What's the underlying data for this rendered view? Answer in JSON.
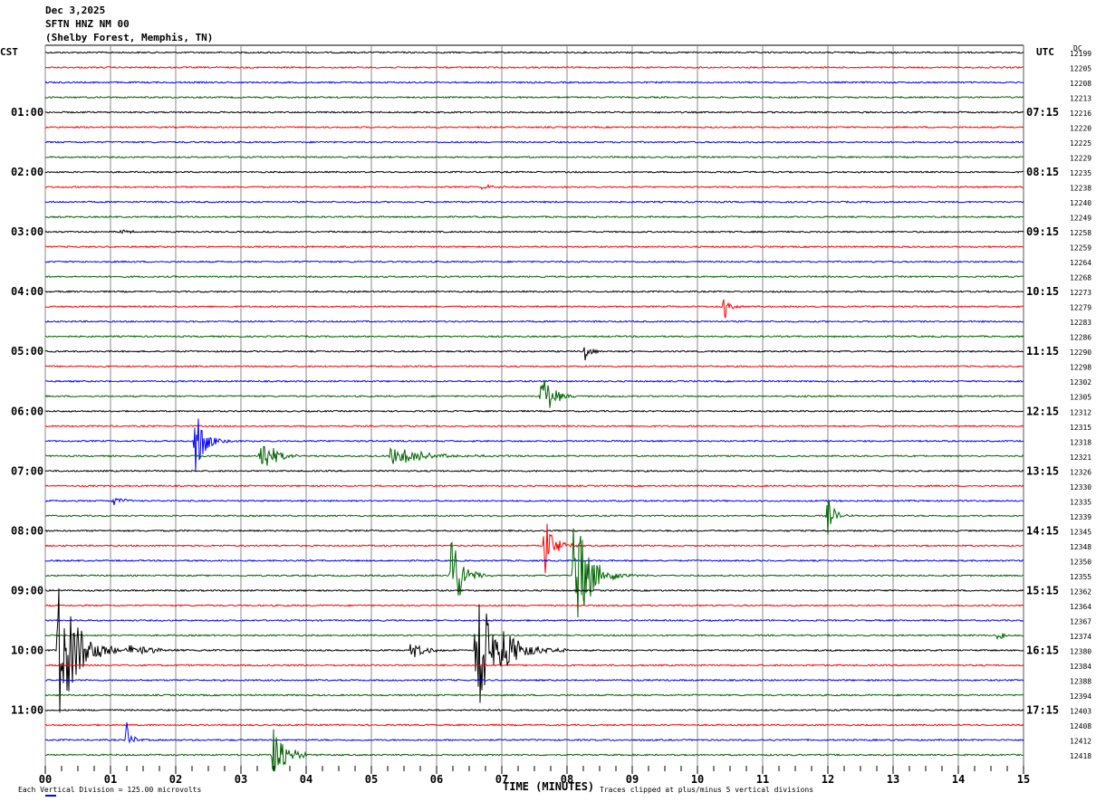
{
  "header": {
    "date": "Dec 3,2025",
    "station": "SFTN HNZ NM 00",
    "location": "(Shelby Forest, Memphis, TN)"
  },
  "left_axis_title": "CST",
  "right_axis_title": "UTC",
  "dc_title": "DC",
  "footer": {
    "scale": "Each Vertical Division =  125.00 microvolts",
    "xlabel": "TIME (MINUTES)",
    "clip_note": "Traces clipped at plus/minus 5 vertical divisions"
  },
  "chart_data": {
    "type": "line",
    "title": "SFTN HNZ NM 00 helicorder",
    "xlabel": "TIME (MINUTES)",
    "xlim": [
      0,
      15
    ],
    "x_ticks": [
      "00",
      "01",
      "02",
      "03",
      "04",
      "05",
      "06",
      "07",
      "08",
      "09",
      "10",
      "11",
      "12",
      "13",
      "14",
      "15"
    ],
    "traces_per_hour": 4,
    "trace_colors": [
      "#000000",
      "#ff0000",
      "#0000ff",
      "#006400"
    ],
    "clip_divisions": 5,
    "cst_labels": [
      "01:00",
      "02:00",
      "03:00",
      "04:00",
      "05:00",
      "06:00",
      "07:00",
      "08:00",
      "09:00",
      "10:00",
      "11:00"
    ],
    "utc_labels": [
      "07:15",
      "08:15",
      "09:15",
      "10:15",
      "11:15",
      "12:15",
      "13:15",
      "14:15",
      "15:15",
      "16:15",
      "17:15"
    ],
    "dc_values": [
      "12199",
      "12205",
      "12208",
      "12213",
      "12216",
      "12220",
      "12225",
      "12229",
      "12235",
      "12238",
      "12240",
      "12249",
      "12258",
      "12259",
      "12264",
      "12268",
      "12273",
      "12279",
      "12283",
      "12286",
      "12290",
      "12298",
      "12302",
      "12305",
      "12312",
      "12315",
      "12318",
      "12321",
      "12326",
      "12330",
      "12335",
      "12339",
      "12345",
      "12348",
      "12350",
      "12355",
      "12362",
      "12364",
      "12367",
      "12374",
      "12380",
      "12384",
      "12388",
      "12394",
      "12403",
      "12408",
      "12412",
      "12418"
    ],
    "events": [
      {
        "trace": 9,
        "minute": 6.7,
        "amplitude_div": 0.2,
        "duration_min": 0.3
      },
      {
        "trace": 12,
        "minute": 1.15,
        "amplitude_div": 0.15,
        "duration_min": 0.4
      },
      {
        "trace": 17,
        "minute": 10.4,
        "amplitude_div": 1.6,
        "duration_min": 0.15
      },
      {
        "trace": 20,
        "minute": 8.28,
        "amplitude_div": 0.7,
        "duration_min": 0.15
      },
      {
        "trace": 23,
        "minute": 7.6,
        "amplitude_div": 1.9,
        "duration_min": 0.35
      },
      {
        "trace": 26,
        "minute": 2.3,
        "amplitude_div": 2.4,
        "duration_min": 0.3
      },
      {
        "trace": 27,
        "minute": 3.3,
        "amplitude_div": 1.5,
        "duration_min": 0.4
      },
      {
        "trace": 27,
        "minute": 5.3,
        "amplitude_div": 0.8,
        "duration_min": 0.9
      },
      {
        "trace": 30,
        "minute": 1.05,
        "amplitude_div": 0.4,
        "duration_min": 0.25
      },
      {
        "trace": 31,
        "minute": 12.0,
        "amplitude_div": 1.3,
        "duration_min": 0.2
      },
      {
        "trace": 33,
        "minute": 7.65,
        "amplitude_div": 2.2,
        "duration_min": 0.3
      },
      {
        "trace": 35,
        "minute": 6.22,
        "amplitude_div": 3.8,
        "duration_min": 0.3
      },
      {
        "trace": 35,
        "minute": 8.1,
        "amplitude_div": 4.4,
        "duration_min": 0.5
      },
      {
        "trace": 40,
        "minute": 0.2,
        "amplitude_div": 5.0,
        "duration_min": 0.6
      },
      {
        "trace": 40,
        "minute": 1.3,
        "amplitude_div": 0.4,
        "duration_min": 0.8
      },
      {
        "trace": 40,
        "minute": 5.6,
        "amplitude_div": 0.7,
        "duration_min": 0.4
      },
      {
        "trace": 40,
        "minute": 6.6,
        "amplitude_div": 5.0,
        "duration_min": 0.7
      },
      {
        "trace": 39,
        "minute": 14.6,
        "amplitude_div": 0.3,
        "duration_min": 0.4
      },
      {
        "trace": 46,
        "minute": 1.25,
        "amplitude_div": 1.2,
        "duration_min": 0.15
      },
      {
        "trace": 47,
        "minute": 3.5,
        "amplitude_div": 2.6,
        "duration_min": 0.35
      }
    ]
  }
}
